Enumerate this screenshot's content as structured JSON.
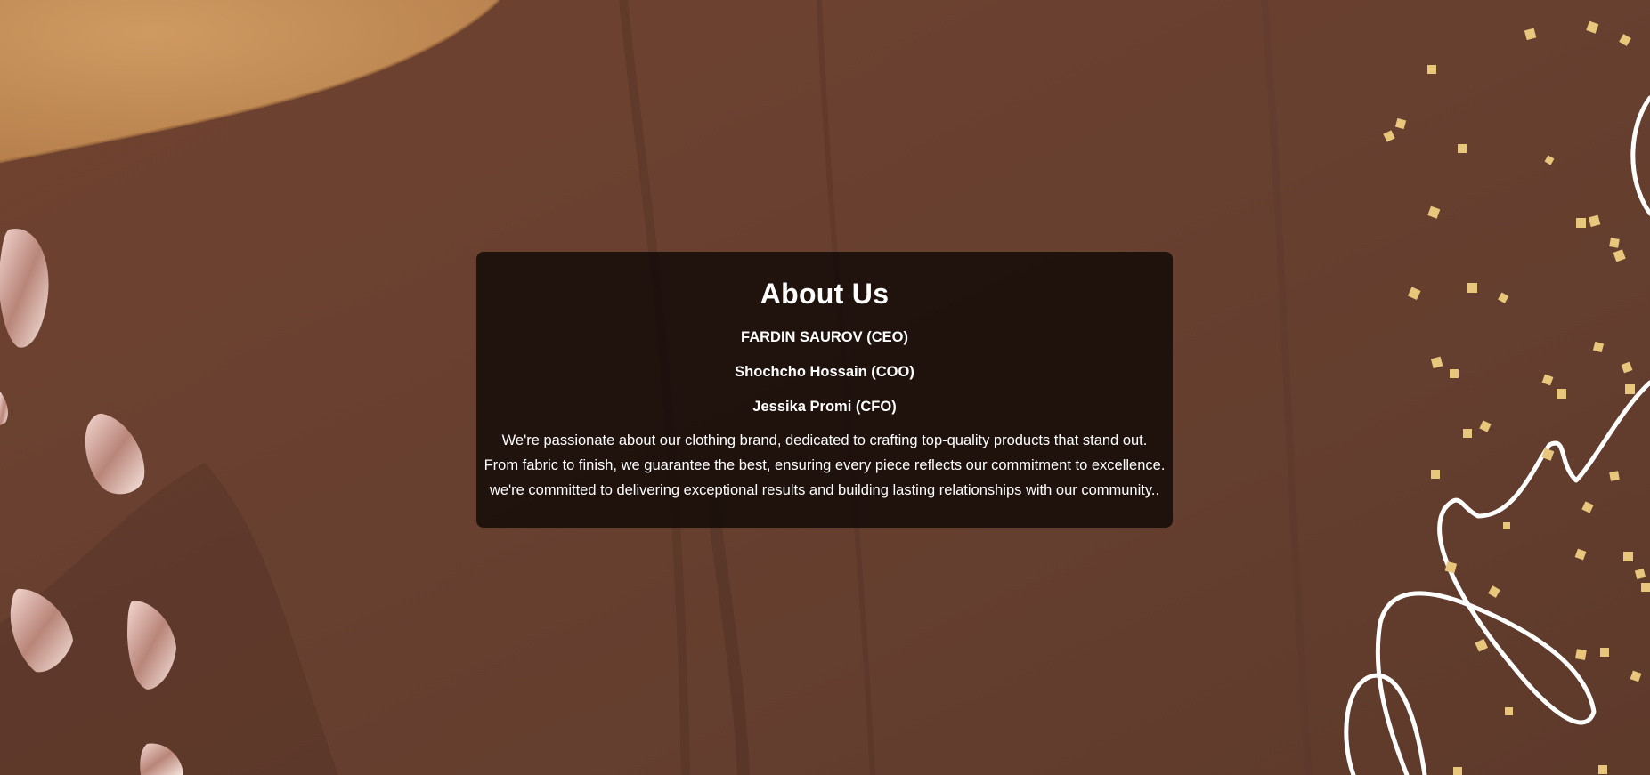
{
  "about": {
    "title": "About Us",
    "members": [
      "FARDIN SAUROV (CEO)",
      "Shochcho Hossain (COO)",
      "Jessika Promi (CFO)"
    ],
    "description_lines": [
      "We're passionate about our clothing brand, dedicated to crafting top-quality products that stand out.",
      "From fabric to finish, we guarantee the best, ensuring every piece reflects our commitment to excellence.",
      "we're committed to delivering exceptional results and building lasting relationships with our community.."
    ]
  },
  "colors": {
    "background_brown": "#6b4130",
    "card_background": "#120a07",
    "accent_tan": "#c8915a",
    "confetti_gold": "#e8c77d",
    "text": "#ffffff"
  }
}
